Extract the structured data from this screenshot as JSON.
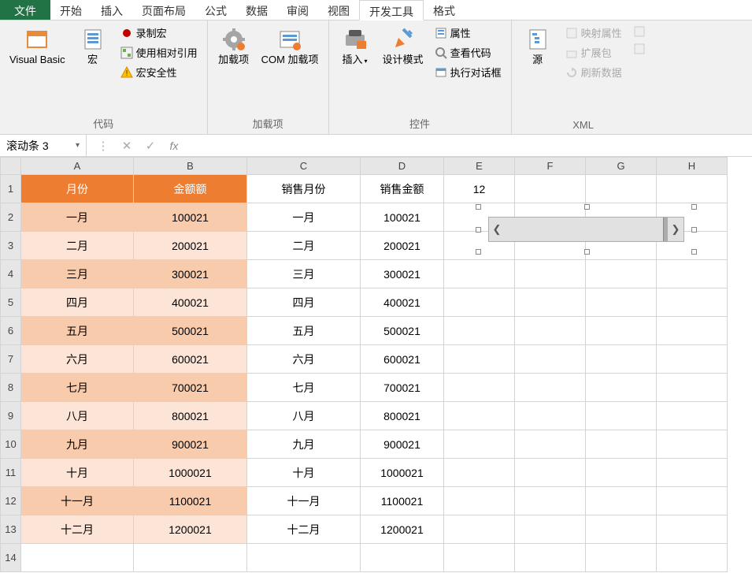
{
  "tabs": {
    "file": "文件",
    "home": "开始",
    "insert": "插入",
    "pagelayout": "页面布局",
    "formulas": "公式",
    "data": "数据",
    "review": "审阅",
    "view": "视图",
    "developer": "开发工具",
    "format": "格式"
  },
  "ribbon": {
    "code": {
      "visual_basic": "Visual Basic",
      "macros": "宏",
      "record_macro": "录制宏",
      "use_relative": "使用相对引用",
      "macro_security": "宏安全性",
      "label": "代码"
    },
    "addins": {
      "addins": "加载项",
      "com_addins": "COM 加载项",
      "label": "加载项"
    },
    "controls": {
      "insert": "插入",
      "design_mode": "设计模式",
      "properties": "属性",
      "view_code": "查看代码",
      "run_dialog": "执行对话框",
      "label": "控件"
    },
    "xml": {
      "source": "源",
      "map_props": "映射属性",
      "expansion": "扩展包",
      "refresh": "刷新数据",
      "label": "XML"
    }
  },
  "formula_bar": {
    "name_box": "滚动条 3",
    "formula": ""
  },
  "columns": [
    "A",
    "B",
    "C",
    "D",
    "E",
    "F",
    "G",
    "H"
  ],
  "row_numbers": [
    "1",
    "2",
    "3",
    "4",
    "5",
    "6",
    "7",
    "8",
    "9",
    "10",
    "11",
    "12",
    "13",
    "14"
  ],
  "headers": {
    "a": "月份",
    "b": "金额额",
    "c": "销售月份",
    "d": "销售金额"
  },
  "e1_value": "12",
  "data_rows": [
    {
      "month": "一月",
      "amount": "100021",
      "smonth": "一月",
      "samount": "100021"
    },
    {
      "month": "二月",
      "amount": "200021",
      "smonth": "二月",
      "samount": "200021"
    },
    {
      "month": "三月",
      "amount": "300021",
      "smonth": "三月",
      "samount": "300021"
    },
    {
      "month": "四月",
      "amount": "400021",
      "smonth": "四月",
      "samount": "400021"
    },
    {
      "month": "五月",
      "amount": "500021",
      "smonth": "五月",
      "samount": "500021"
    },
    {
      "month": "六月",
      "amount": "600021",
      "smonth": "六月",
      "samount": "600021"
    },
    {
      "month": "七月",
      "amount": "700021",
      "smonth": "七月",
      "samount": "700021"
    },
    {
      "month": "八月",
      "amount": "800021",
      "smonth": "八月",
      "samount": "800021"
    },
    {
      "month": "九月",
      "amount": "900021",
      "smonth": "九月",
      "samount": "900021"
    },
    {
      "month": "十月",
      "amount": "1000021",
      "smonth": "十月",
      "samount": "1000021"
    },
    {
      "month": "十一月",
      "amount": "1100021",
      "smonth": "十一月",
      "samount": "1100021"
    },
    {
      "month": "十二月",
      "amount": "1200021",
      "smonth": "十二月",
      "samount": "1200021"
    }
  ]
}
